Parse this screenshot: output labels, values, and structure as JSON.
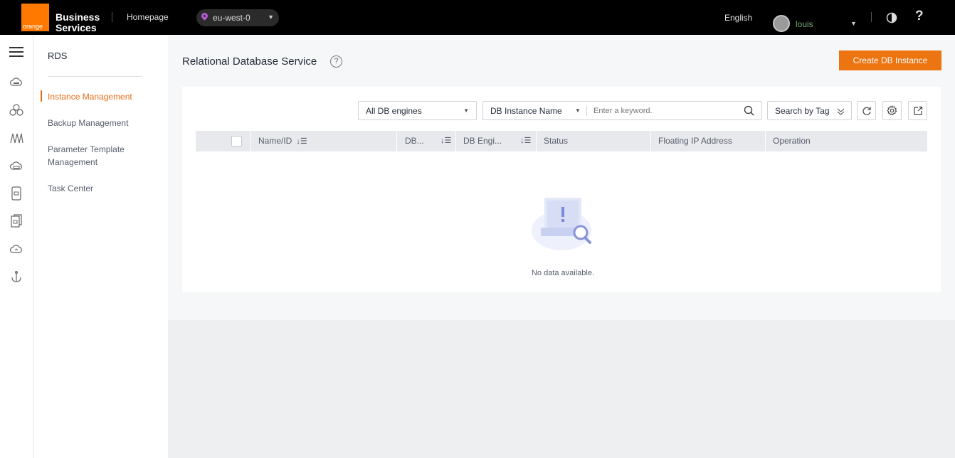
{
  "header": {
    "logo_text": "orange",
    "brand_line1": "Business",
    "brand_line2": "Services",
    "homepage": "Homepage",
    "region": "eu-west-0",
    "language": "English",
    "username": "louis",
    "help": "?"
  },
  "rail": {
    "icons": [
      "menu-icon",
      "cloud-server-icon",
      "cluster-icon",
      "network-icon",
      "cloud-storage-icon",
      "mobile-icon",
      "document-icon",
      "cloud-icon",
      "anchor-icon"
    ]
  },
  "sidebar": {
    "title": "RDS",
    "items": [
      {
        "label": "Instance Management",
        "active": true
      },
      {
        "label": "Backup Management",
        "active": false
      },
      {
        "label": "Parameter Template Management",
        "active": false
      },
      {
        "label": "Task Center",
        "active": false
      }
    ]
  },
  "main": {
    "title": "Relational Database Service",
    "help_icon": "?",
    "create_button": "Create DB Instance",
    "filters": {
      "engine_select": "All DB engines",
      "field_select": "DB Instance Name",
      "search_placeholder": "Enter a keyword.",
      "tag_search": "Search by Tag"
    },
    "table": {
      "columns": [
        "Name/ID",
        "DB...",
        "DB Engi...",
        "Status",
        "Floating IP Address",
        "Operation"
      ],
      "rows": []
    },
    "empty_text": "No data available."
  },
  "colors": {
    "accent": "#ec7411",
    "topbar": "#000000",
    "active_nav": "#e86f17"
  }
}
